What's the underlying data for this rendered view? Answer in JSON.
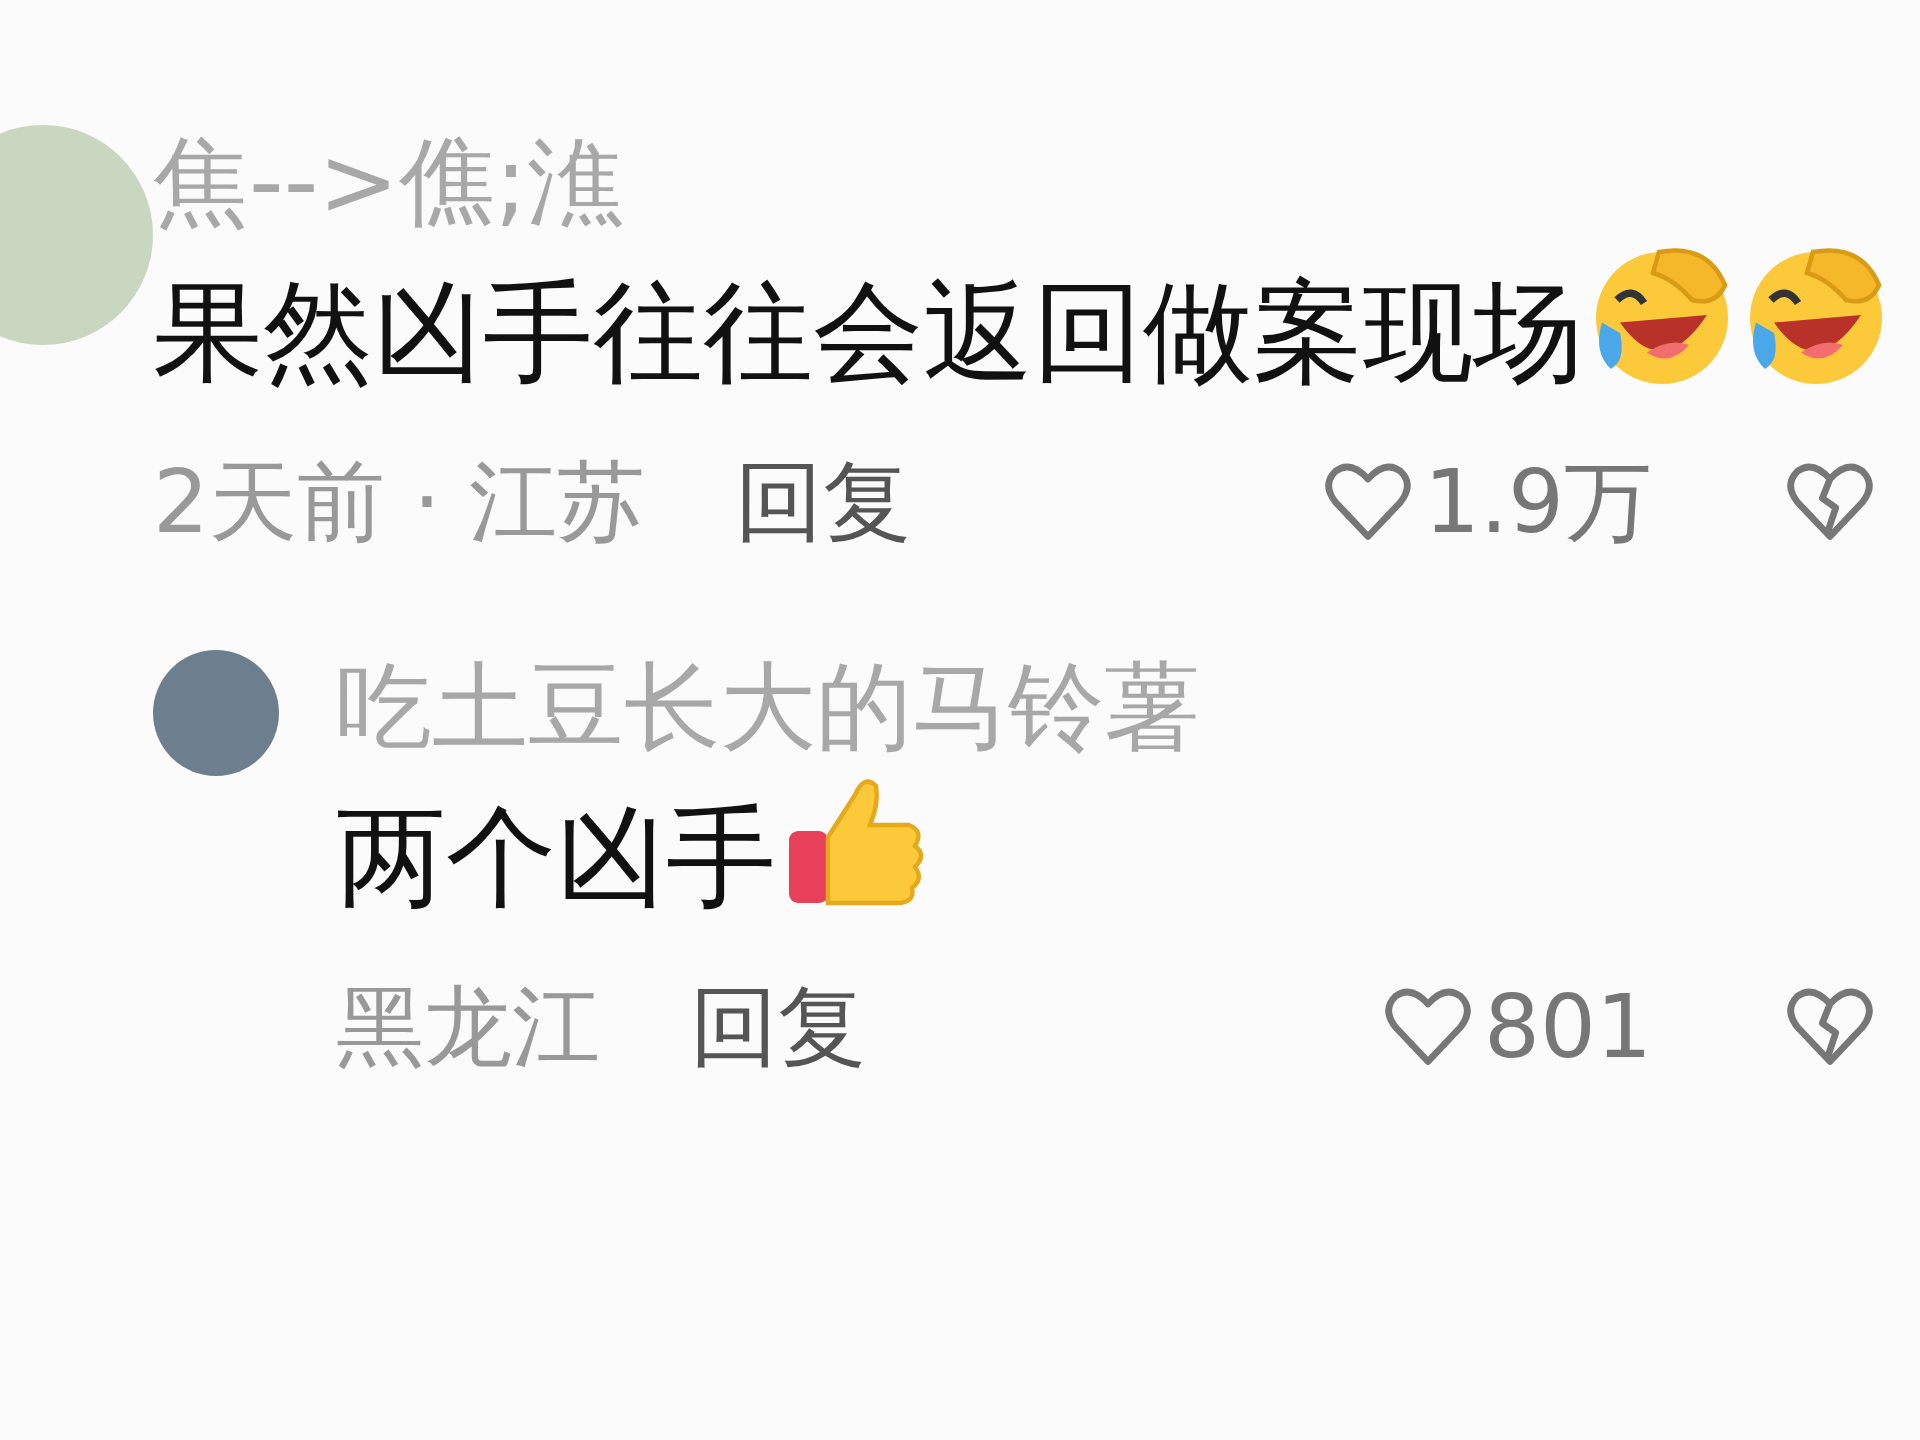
{
  "comments": [
    {
      "author": "焦-->僬;潐",
      "text": "果然凶手往往会返回做案现场",
      "stickers": [
        {
          "kind": "laughing"
        },
        {
          "kind": "laughing"
        }
      ],
      "meta": "2天前 · 江苏",
      "reply_label": "回复",
      "likes": "1.9万",
      "replies": [
        {
          "author": "吃土豆长大的马铃薯",
          "text": "两个凶手",
          "stickers": [
            {
              "kind": "thumbs_up"
            }
          ],
          "meta": "黑龙江",
          "reply_label": "回复",
          "likes": "801"
        }
      ]
    }
  ]
}
